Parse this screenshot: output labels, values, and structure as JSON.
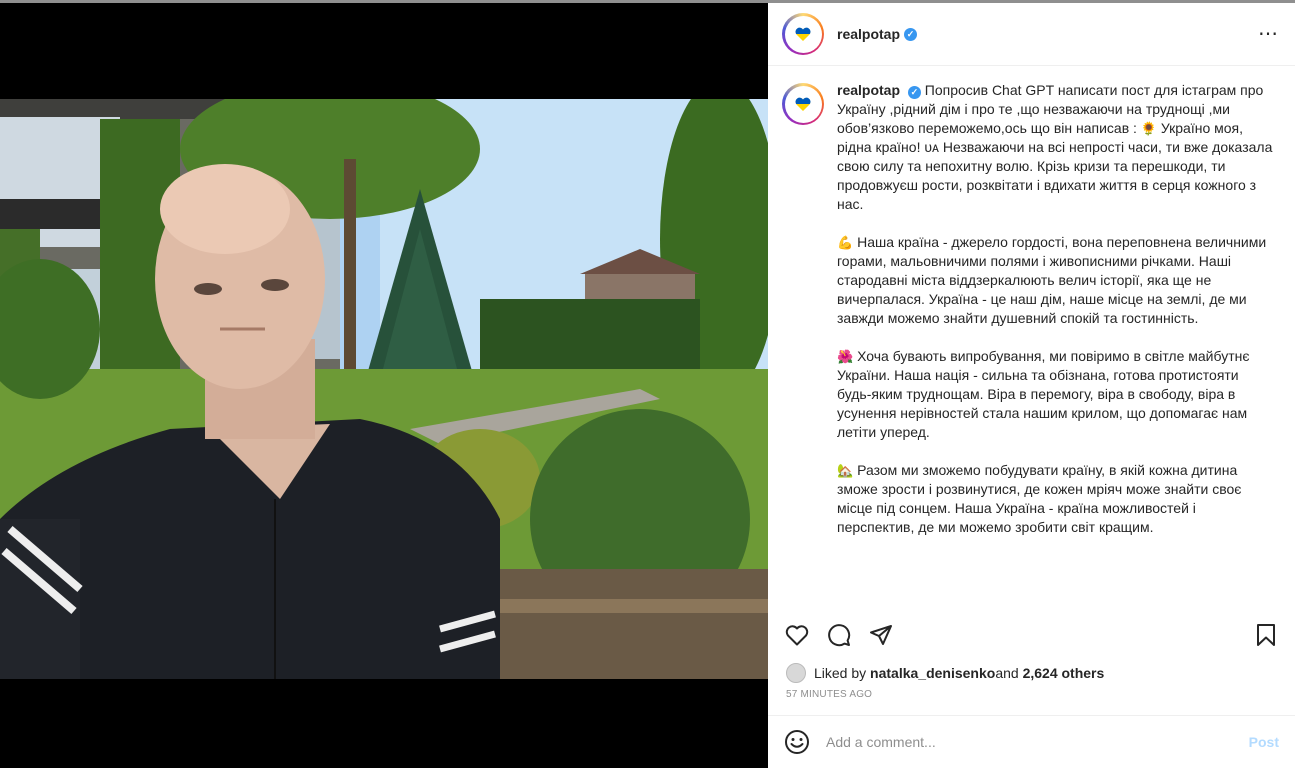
{
  "post": {
    "username": "realpotap",
    "verified_mark": "✓",
    "more_icon": "⋯",
    "caption": {
      "p1_line": "Попросив Chat GPT написати пост для істаграм про Україну ,рідний дім і про те ,що незважаючи на труднощі ,ми обов’язково переможемо,ось що він написав : ",
      "p1_emoji1": "🌻",
      "p1_mid": " Україно моя, рідна країно! ",
      "p1_emoji2": "ᴜᴀ",
      "p1_rest": " Незважаючи на всі непрості часи, ти вже доказала свою силу та непохитну волю. Крізь кризи та перешкоди, ти продовжуєш рости, розквітати і вдихати життя в серця кожного з нас.",
      "p2_emoji": "💪",
      "p2": " Наша країна - джерело гордості, вона переповнена величними горами, мальовничими полями і живописними річками. Наші стародавні міста віддзеркалюють велич історії, яка ще не вичерпалася. Україна - це наш дім, наше місце на землі, де ми завжди можемо знайти душевний спокій та гостинність.",
      "p3_emoji": "🌺",
      "p3": " Хоча бувають випробування, ми повіримо в світле майбутнє України. Наша нація - сильна та обізнана, готова протистояти будь-яким труднощам. Віра в перемогу, віра в свободу, віра в усунення нерівностей стала нашим крилом, що допомагає нам летіти уперед.",
      "p4_emoji": "🏡",
      "p4": " Разом ми зможемо побудувати країну, в якій кожна дитина зможе зрости і розвинутися, де кожен мріяч може знайти своє місце під сонцем. Наша Україна - країна можливостей і перспектив, де ми можемо зробити світ кращим."
    },
    "likes": {
      "prefix": "Liked by ",
      "liker": "natalka_denisenko",
      "middle": " and ",
      "others": "2,624 others"
    },
    "timestamp": "57 MINUTES AGO",
    "comment": {
      "placeholder": "Add a comment...",
      "post_label": "Post"
    }
  },
  "icons": [
    "heart-icon",
    "comment-icon",
    "share-icon",
    "bookmark-icon",
    "emoji-icon",
    "more-options-icon",
    "verified-badge-icon"
  ],
  "colors": {
    "verified": "#3897f0",
    "post_disabled": "#b3dbff",
    "muted": "#8e8e8e"
  }
}
